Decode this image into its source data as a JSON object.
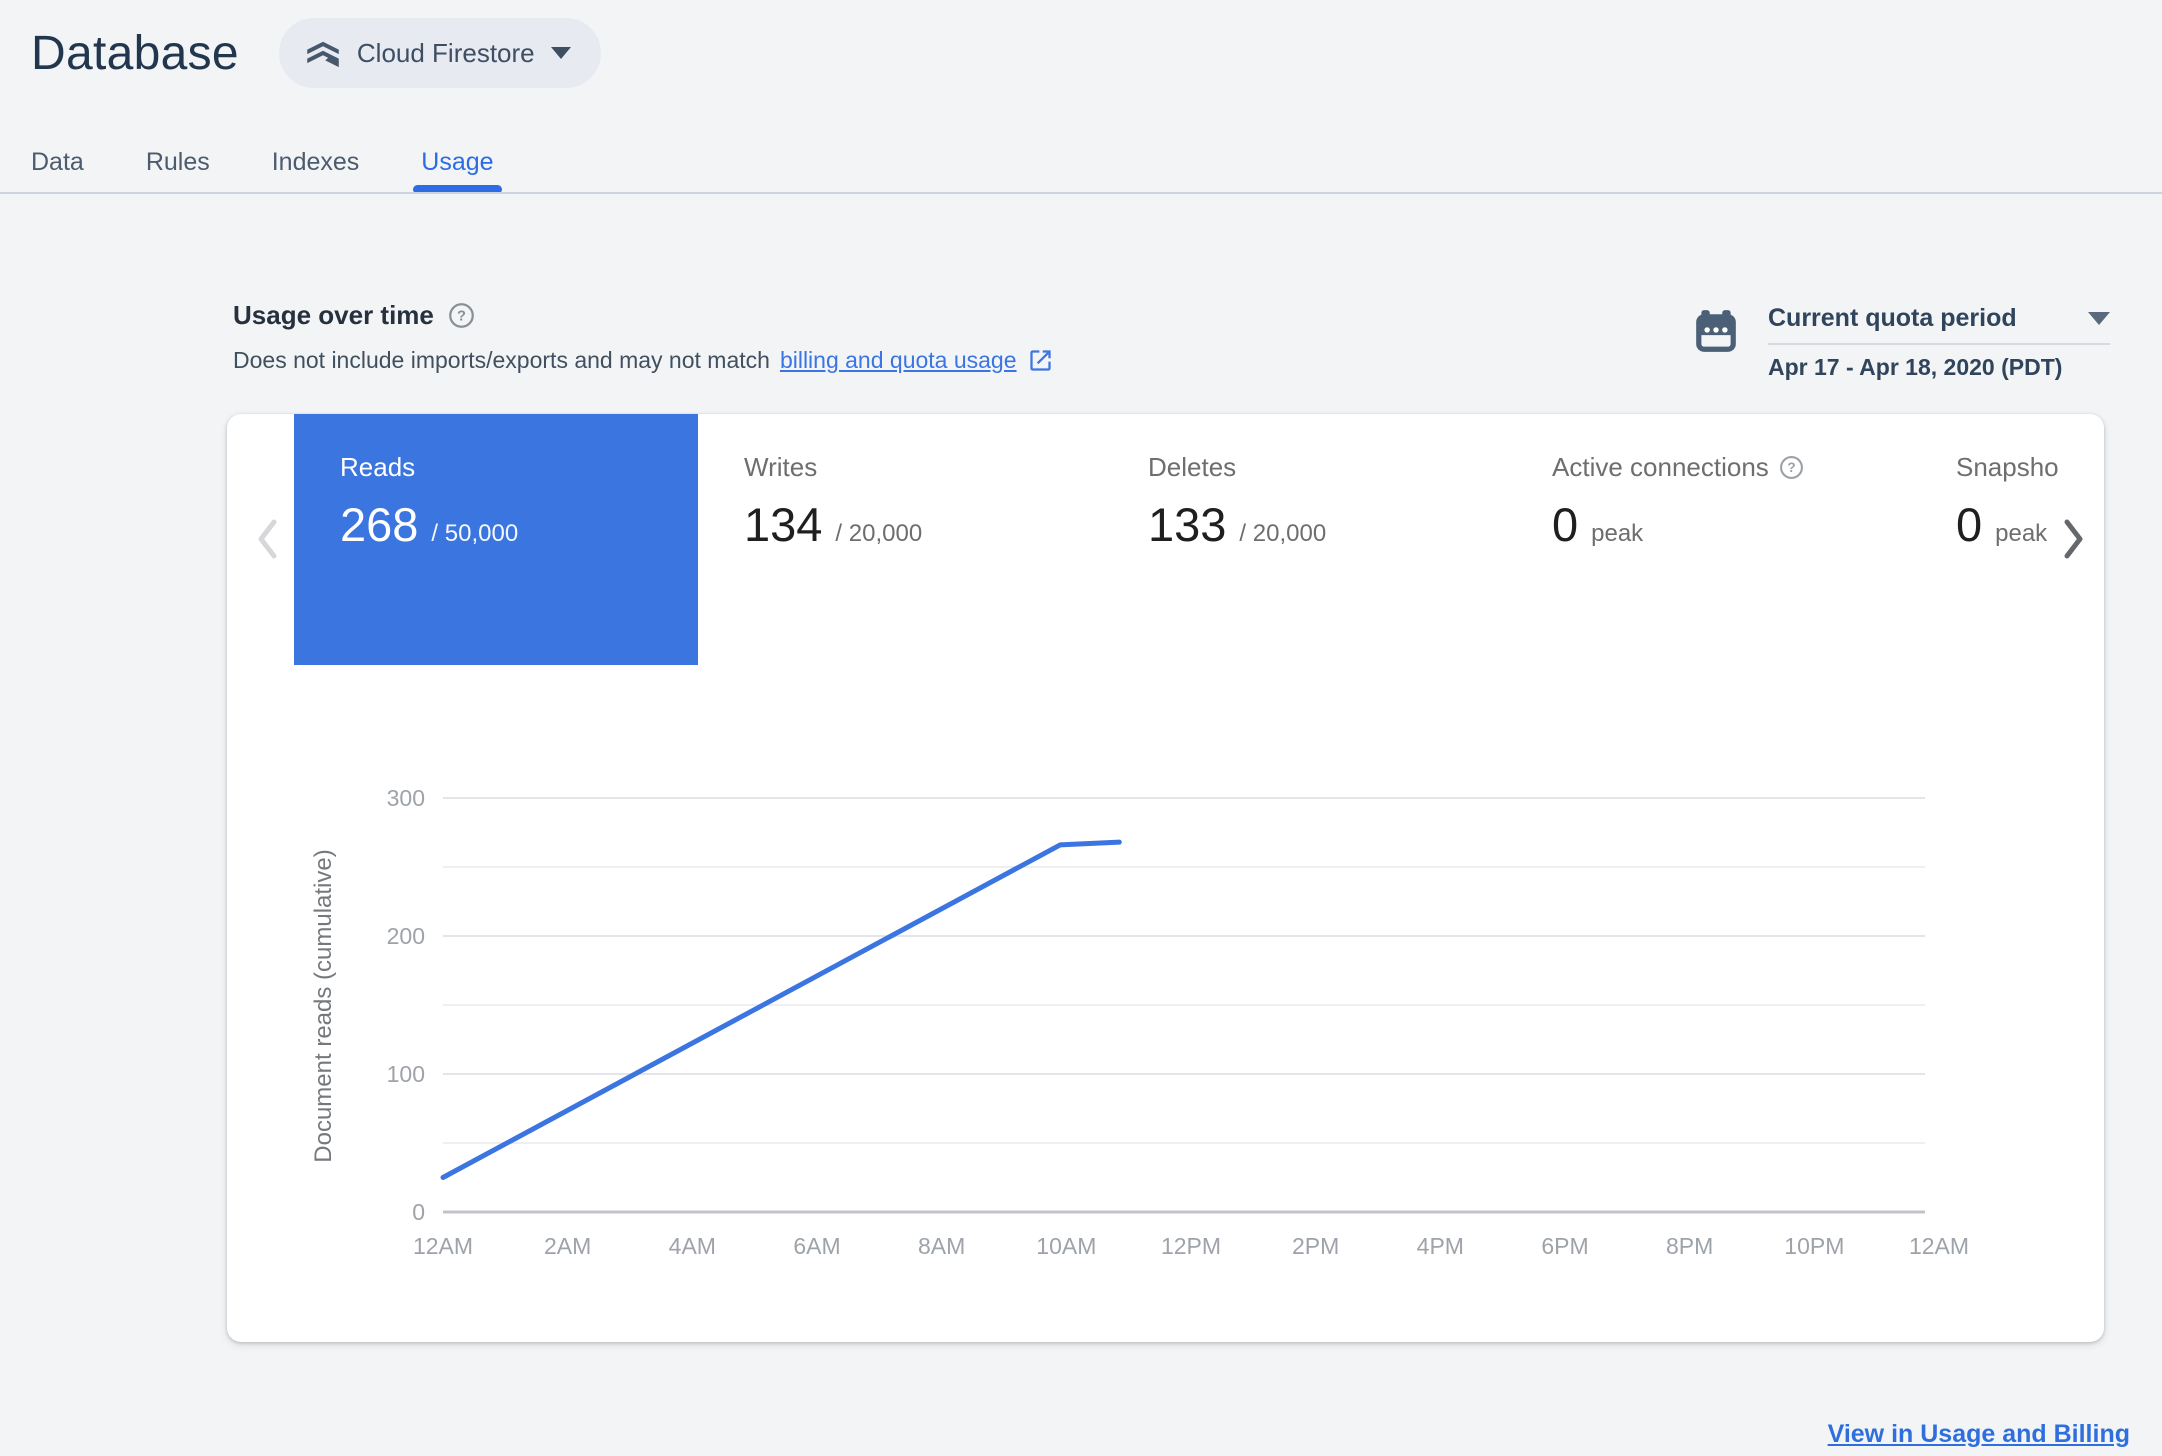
{
  "header": {
    "title": "Database",
    "product": "Cloud Firestore"
  },
  "tabs": [
    {
      "label": "Data",
      "active": false
    },
    {
      "label": "Rules",
      "active": false
    },
    {
      "label": "Indexes",
      "active": false
    },
    {
      "label": "Usage",
      "active": true
    }
  ],
  "usage_section": {
    "title": "Usage over time",
    "description": "Does not include imports/exports and may not match",
    "link_text": "billing and quota usage"
  },
  "quota_period": {
    "label": "Current quota period",
    "date_range": "Apr 17 - Apr 18, 2020 (PDT)"
  },
  "metrics": [
    {
      "label": "Reads",
      "value": "268",
      "denominator": "/ 50,000",
      "selected": true,
      "help": false
    },
    {
      "label": "Writes",
      "value": "134",
      "denominator": "/ 20,000",
      "selected": false,
      "help": false
    },
    {
      "label": "Deletes",
      "value": "133",
      "denominator": "/ 20,000",
      "selected": false,
      "help": false
    },
    {
      "label": "Active connections",
      "value": "0",
      "denominator": "peak",
      "selected": false,
      "help": true
    },
    {
      "label": "Snapsho",
      "value": "0",
      "denominator": "peak",
      "selected": false,
      "help": false
    }
  ],
  "footer": {
    "link": "View in Usage and Billing"
  },
  "colors": {
    "tile_blue": "#3a75e0",
    "tab_blue": "#2d6ce3",
    "link_blue": "#3b75e4",
    "line_blue": "#3b75e1",
    "grid_major": "#e3e5e8",
    "grid_minor": "#edeff1",
    "axis_line": "#c0c4c8",
    "axis_text": "#9ea3a9"
  },
  "chart_data": {
    "type": "line",
    "title": "",
    "ylabel": "Document reads (cumulative)",
    "x_tick_labels": [
      "12AM",
      "2AM",
      "4AM",
      "6AM",
      "8AM",
      "10AM",
      "12PM",
      "2PM",
      "4PM",
      "6PM",
      "8PM",
      "10PM",
      "12AM"
    ],
    "x_axis_hours_range": [
      0,
      24
    ],
    "y_ticks": [
      0,
      100,
      200,
      300
    ],
    "y_minor_gridlines": [
      50,
      150,
      250
    ],
    "ylim": [
      0,
      300
    ],
    "grid": true,
    "legend": false,
    "series": [
      {
        "name": "Document reads (cumulative)",
        "points_hours_value": [
          [
            0,
            25
          ],
          [
            9.9,
            266
          ],
          [
            10.85,
            268
          ]
        ]
      }
    ]
  }
}
